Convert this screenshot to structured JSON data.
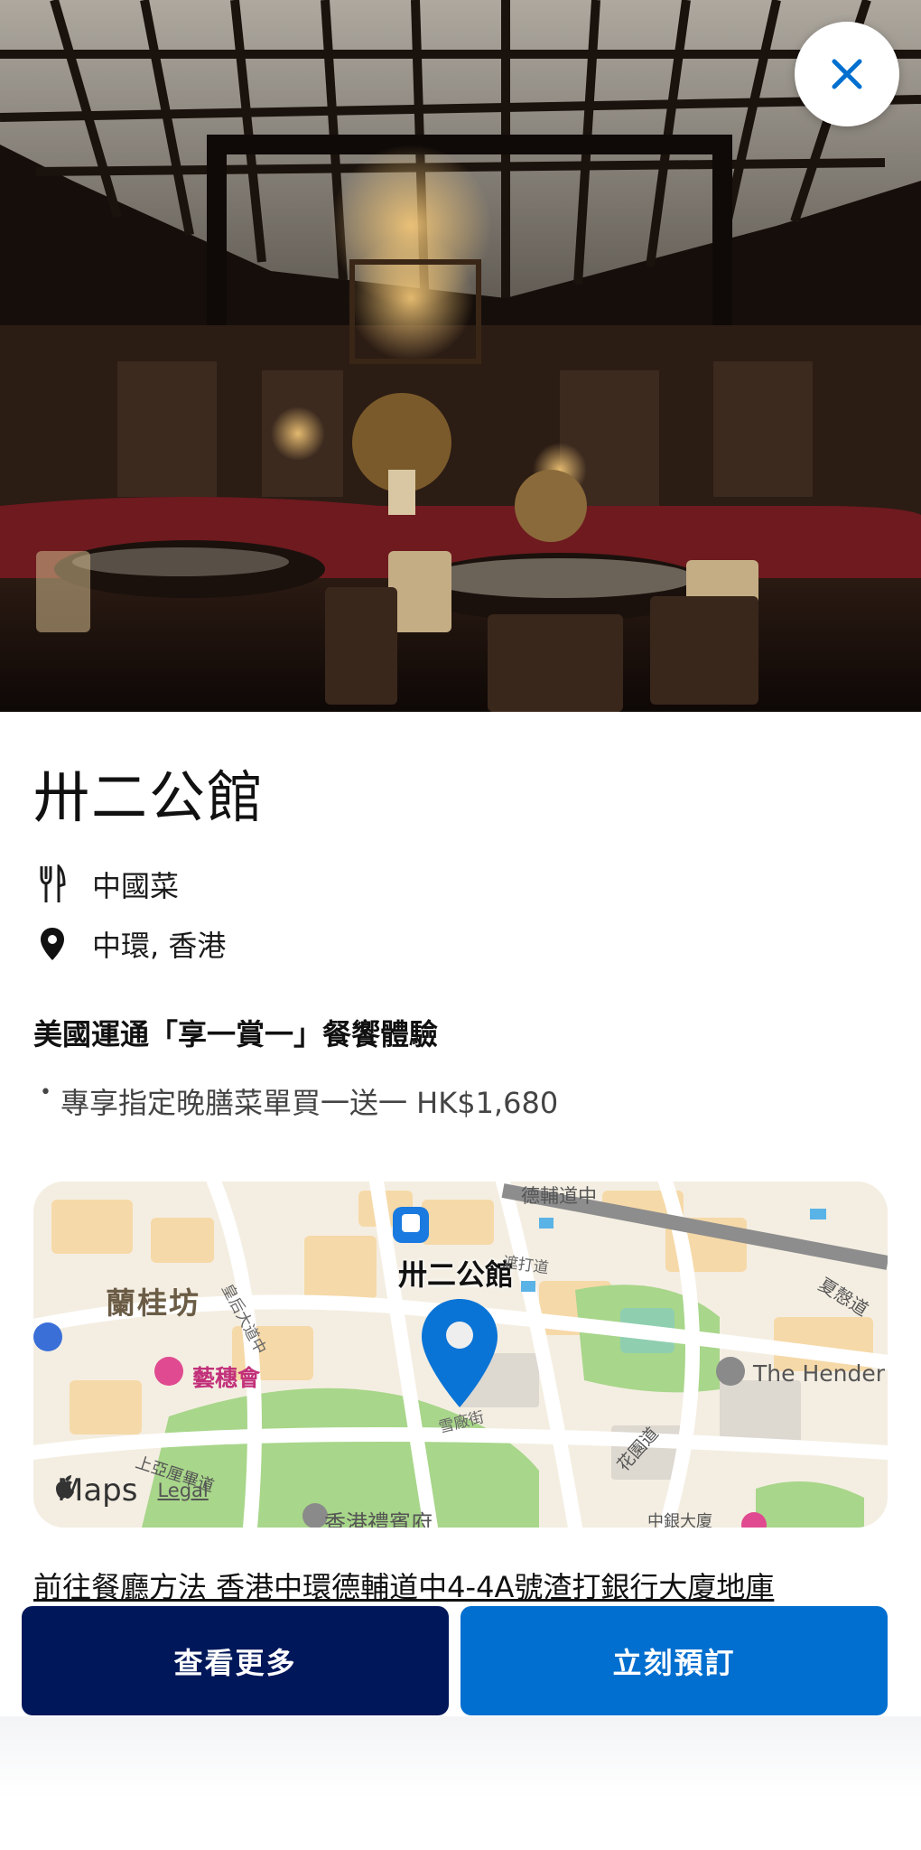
{
  "hero": {
    "image_alt": "restaurant-interior-photo"
  },
  "close_button": {
    "icon": "close-icon",
    "color": "#006fcf"
  },
  "restaurant": {
    "name": "卅二公館",
    "cuisine": "中國菜",
    "location": "中環, 香港"
  },
  "offer": {
    "title": "美國運通「享一賞一」餐饗體驗",
    "items": [
      "專享指定晚膳菜單買一送一 HK$1,680"
    ]
  },
  "map": {
    "labels": {
      "lan_kwai_fong": "蘭桂坊",
      "yi_sui_wui": "藝穗會",
      "restaurant": "卅二公館",
      "henderson": "The Hender",
      "government_house": "香港禮賓府",
      "bank_of_china": "中銀大廈",
      "queens_road": "皇后大道中",
      "duddell_street": "雪廠街",
      "garden_road": "花園道",
      "harcourt_road": "夏慤道",
      "upper_albert_road": "上亞厘畢道",
      "ice_house_street": "遮打道",
      "des_voeux_road": "德輔道中"
    },
    "attribution": "Maps",
    "legal": "Legal",
    "pin_color": "#0a74d6"
  },
  "directions": "前往餐廳方法 香港中環德輔道中4-4A號渣打銀行大廈地庫",
  "buttons": {
    "more": "查看更多",
    "book": "立刻預訂"
  },
  "colors": {
    "primary_dark": "#00175a",
    "primary_blue": "#006fcf"
  }
}
